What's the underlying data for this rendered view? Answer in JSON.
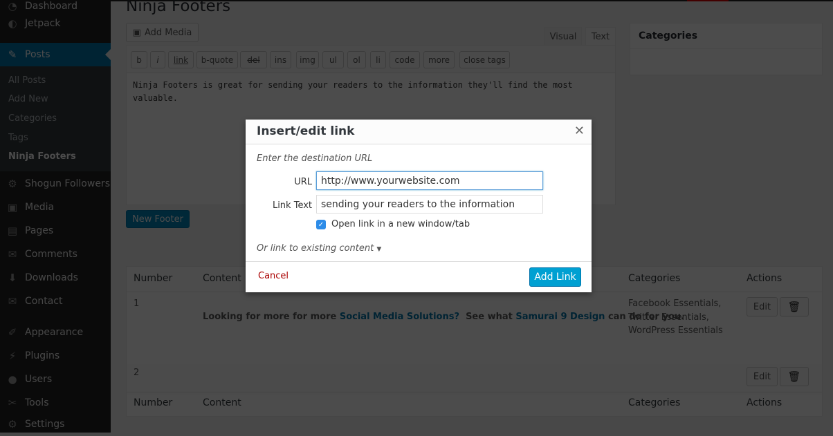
{
  "sidebar": {
    "items": [
      {
        "label": "Dashboard",
        "icon": "dashboard-icon",
        "glyph": "◔"
      },
      {
        "label": "Jetpack",
        "icon": "jetpack-icon",
        "glyph": "◐"
      },
      {
        "label": "Posts",
        "icon": "pin-icon",
        "glyph": "✎"
      },
      {
        "label": "Shogun Followers",
        "icon": "gear-icon",
        "glyph": "⚙"
      },
      {
        "label": "Media",
        "icon": "media-icon",
        "glyph": "▣"
      },
      {
        "label": "Pages",
        "icon": "pages-icon",
        "glyph": "▤"
      },
      {
        "label": "Comments",
        "icon": "comment-icon",
        "glyph": "✉"
      },
      {
        "label": "Downloads",
        "icon": "download-icon",
        "glyph": "⬇"
      },
      {
        "label": "Contact",
        "icon": "mail-icon",
        "glyph": "✉"
      },
      {
        "label": "Appearance",
        "icon": "brush-icon",
        "glyph": "✐"
      },
      {
        "label": "Plugins",
        "icon": "plugin-icon",
        "glyph": "⚡"
      },
      {
        "label": "Users",
        "icon": "user-icon",
        "glyph": "●"
      },
      {
        "label": "Tools",
        "icon": "wrench-icon",
        "glyph": "✂"
      },
      {
        "label": "Settings",
        "icon": "settings-icon",
        "glyph": "⚙"
      }
    ],
    "submenu": [
      "All Posts",
      "Add New",
      "Categories",
      "Tags",
      "Ninja Footers"
    ]
  },
  "page": {
    "title": "Ninja Footers",
    "add_media": "Add Media",
    "tab_visual": "Visual",
    "tab_text": "Text",
    "quicktags": [
      "b",
      "i",
      "link",
      "b-quote",
      "del",
      "ins",
      "img",
      "ul",
      "ol",
      "li",
      "code",
      "more",
      "close tags"
    ],
    "content": "Ninja Footers is great for sending your readers to the information they'll find the most valuable.",
    "new_footer": "New Footer"
  },
  "categories_box": {
    "title": "Categories"
  },
  "table": {
    "headers": [
      "Number",
      "Content",
      "Categories",
      "Actions"
    ],
    "rows": [
      {
        "number": "1",
        "content_pre": "Looking for more for more ",
        "link1": "Social Media Solutions?",
        "content_mid": "  See what ",
        "link2": "Samurai 9 Design",
        "content_post": " can do for you.",
        "categories": [
          "Facebook Essentials,",
          "Twitter Essentials,",
          "WordPress Essentials"
        ]
      },
      {
        "number": "2"
      }
    ],
    "edit": "Edit"
  },
  "modal": {
    "title": "Insert/edit link",
    "instructions": "Enter the destination URL",
    "url_label": "URL",
    "url_value": "http://www.yourwebsite.com",
    "text_label": "Link Text",
    "text_value": "sending your readers to the information",
    "new_tab_label": "Open link in a new window/tab",
    "new_tab_checked": true,
    "existing": "Or link to existing content",
    "cancel": "Cancel",
    "add_link": "Add Link"
  },
  "colors": {
    "accent": "#0073aa",
    "button": "#00a0d2",
    "cancel": "#a00"
  }
}
